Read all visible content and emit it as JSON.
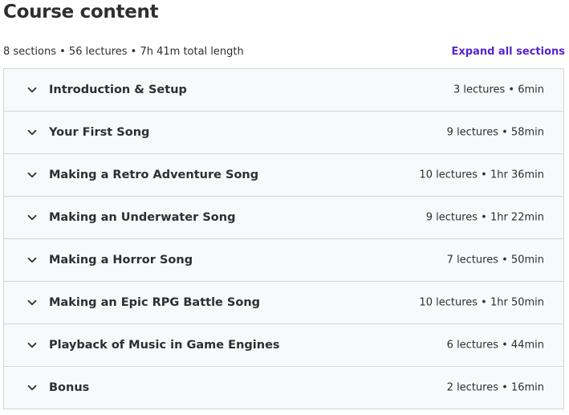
{
  "page_title": "Course content",
  "summary": "8 sections • 56 lectures • 7h 41m total length",
  "expand_all_label": "Expand all sections",
  "colors": {
    "link": "#5624d0",
    "section_bg": "#f7f9fa",
    "border": "#d1d7dc",
    "text": "#2d2f31"
  },
  "sections": [
    {
      "title": "Introduction & Setup",
      "meta": "3 lectures • 6min",
      "icon": "chevron-down-icon"
    },
    {
      "title": "Your First Song",
      "meta": "9 lectures • 58min",
      "icon": "chevron-down-icon"
    },
    {
      "title": "Making a Retro Adventure Song",
      "meta": "10 lectures • 1hr 36min",
      "icon": "chevron-down-icon"
    },
    {
      "title": "Making an Underwater Song",
      "meta": "9 lectures • 1hr 22min",
      "icon": "chevron-down-icon"
    },
    {
      "title": "Making a Horror Song",
      "meta": "7 lectures • 50min",
      "icon": "chevron-down-icon"
    },
    {
      "title": "Making an Epic RPG Battle Song",
      "meta": "10 lectures • 1hr 50min",
      "icon": "chevron-down-icon"
    },
    {
      "title": "Playback of Music in Game Engines",
      "meta": "6 lectures • 44min",
      "icon": "chevron-down-icon"
    },
    {
      "title": "Bonus",
      "meta": "2 lectures • 16min",
      "icon": "chevron-down-icon"
    }
  ]
}
